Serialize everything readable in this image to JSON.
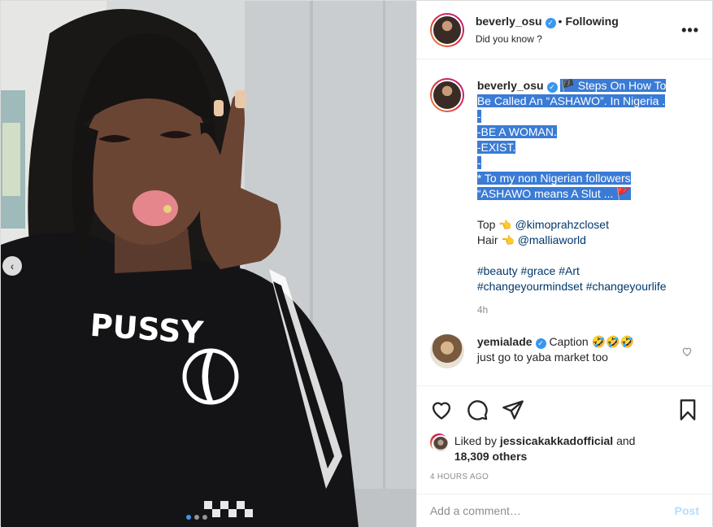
{
  "header": {
    "username": "beverly_osu",
    "separator": "•",
    "follow_status": "Following",
    "location": "Did you know ?",
    "more_label": "•••"
  },
  "caption": {
    "username": "beverly_osu",
    "lines": [
      "🏴 Steps On How To",
      "Be Called An “ASHAWO”. In Nigeria .",
      "-",
      "-BE A WOMAN.",
      "-EXIST.",
      "-",
      "* To my non Nigerian followers",
      "“ASHAWO means A Slut ... 🚩"
    ],
    "top_label": "Top",
    "top_handle": "@kimoprahzcloset",
    "hair_label": "Hair",
    "hair_handle": "@malliaworld",
    "hashtags_line1": "#beauty #grace #Art",
    "hashtags_line2": "#changeyourmindset #changeyourlife",
    "time": "4h",
    "pointing_glyph": "👈"
  },
  "comment": {
    "username": "yemialade",
    "text_line1": "Caption 🤣🤣🤣",
    "text_line2": "just go to yaba market too"
  },
  "likes": {
    "prefix": "Liked by",
    "user": "jessicakakkadofficial",
    "and": "and",
    "others": "18,309 others"
  },
  "timestamp": "4 HOURS AGO",
  "add_comment": {
    "placeholder": "Add a comment…",
    "post_label": "Post"
  },
  "media": {
    "shirt_text": "PUSSY",
    "prev_arrow": "‹",
    "carousel_count": 3,
    "carousel_active": 1
  },
  "colors": {
    "link": "#00376b",
    "verified": "#3897f0",
    "selection": "#3a7bd5",
    "post_disabled": "#b2dffc"
  },
  "icons": [
    "heart-icon",
    "comment-icon",
    "share-icon",
    "save-icon",
    "verified-icon",
    "more-icon",
    "chevron-left-icon",
    "heart-small-icon"
  ]
}
